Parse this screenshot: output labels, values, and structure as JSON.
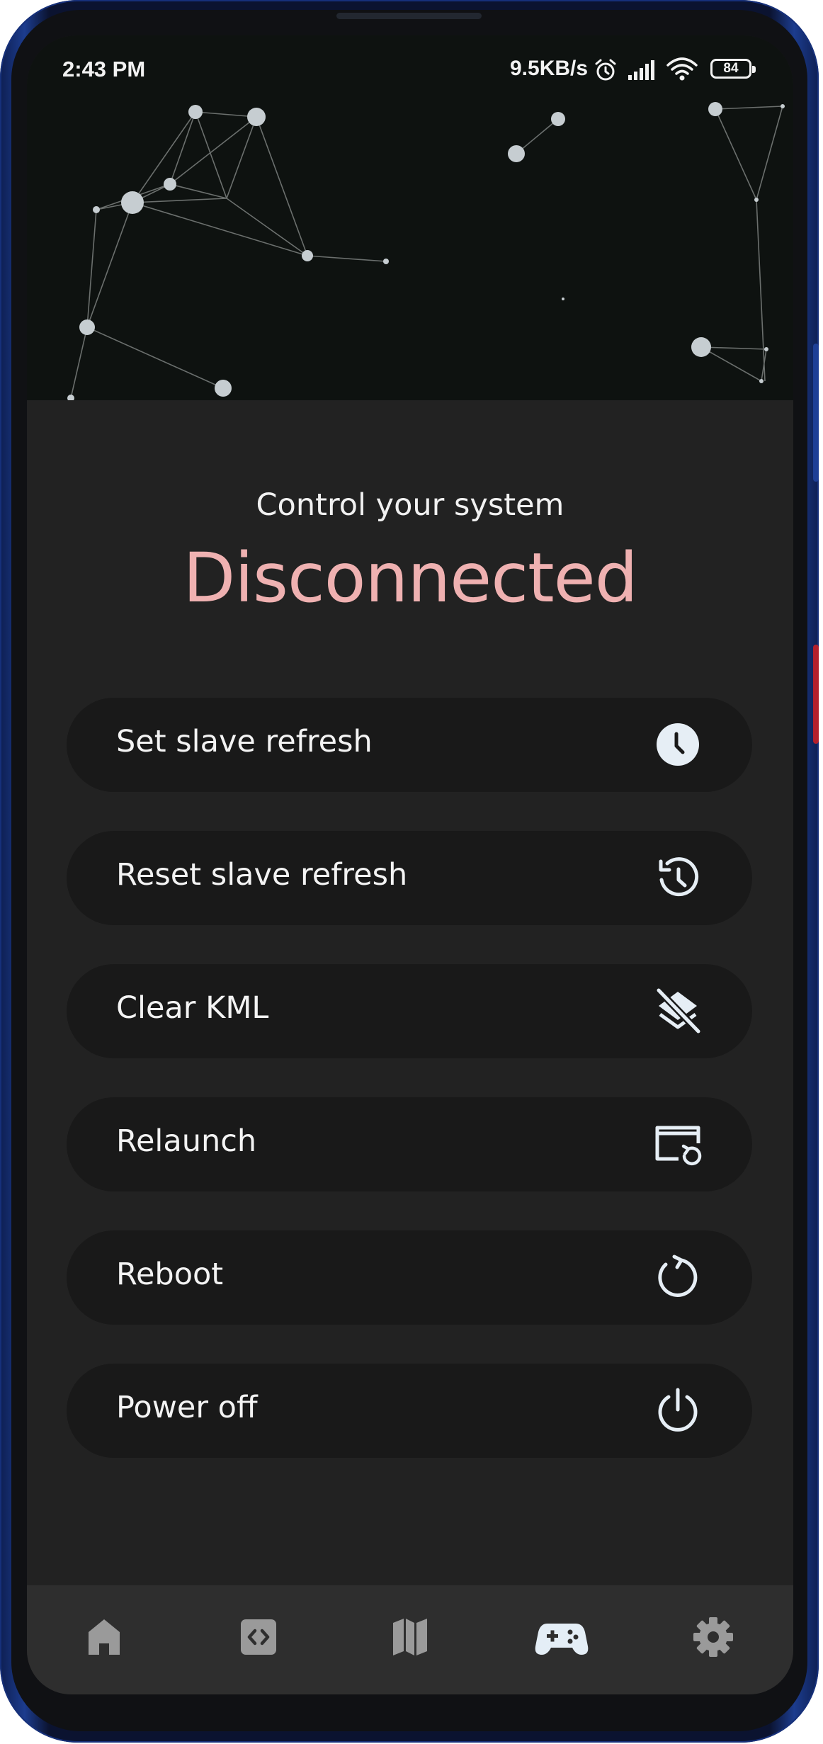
{
  "status_bar": {
    "time": "2:43 PM",
    "network_speed": "9.5KB/s",
    "battery_level": "84",
    "icons": [
      "alarm-icon",
      "signal-icon",
      "wifi-icon",
      "battery-icon"
    ]
  },
  "header": {
    "background_color": "#0e1210",
    "decoration": "network-graph-animation"
  },
  "main": {
    "subtitle": "Control your system",
    "connection_status": "Disconnected",
    "status_color": "#efb1b1",
    "actions": [
      {
        "label": "Set slave refresh",
        "icon": "clock-icon"
      },
      {
        "label": "Reset slave refresh",
        "icon": "history-icon"
      },
      {
        "label": "Clear KML",
        "icon": "layers-clear-icon"
      },
      {
        "label": "Relaunch",
        "icon": "relaunch-screen-icon"
      },
      {
        "label": "Reboot",
        "icon": "restart-icon"
      },
      {
        "label": "Power off",
        "icon": "power-icon"
      }
    ]
  },
  "bottom_nav": {
    "items": [
      {
        "icon": "home-icon",
        "active": false
      },
      {
        "icon": "code-icon",
        "active": false
      },
      {
        "icon": "map-icon",
        "active": false
      },
      {
        "icon": "gamepad-icon",
        "active": true
      },
      {
        "icon": "settings-icon",
        "active": false
      }
    ],
    "active_color": "#e4eef6",
    "inactive_color": "#9a9a9a"
  }
}
